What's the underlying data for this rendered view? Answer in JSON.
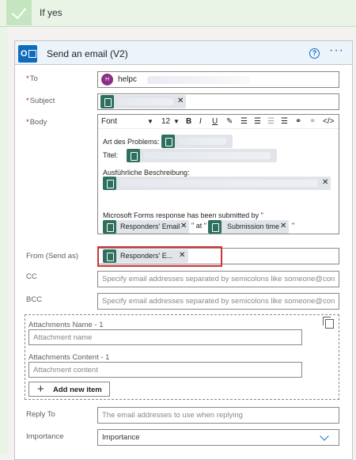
{
  "condition": {
    "label": "If yes"
  },
  "action": {
    "title": "Send an email (V2)",
    "help": "?",
    "more": "···"
  },
  "to": {
    "label": "To",
    "avatar": "H",
    "value": "helpc"
  },
  "subject": {
    "label": "Subject"
  },
  "body": {
    "label": "Body",
    "toolbar": {
      "font": "Font",
      "size": "12",
      "bold": "B",
      "italic": "I",
      "underline": "U"
    },
    "line1": "Art des Problems:",
    "line2": "Titel:",
    "line3": "Ausführliche Beschreibung:",
    "line4": "Microsoft Forms response has been submitted by \"",
    "token_email": "Responders' Email",
    "at_text": "\" at \"",
    "token_time": "Submission time",
    "end_quote": "\""
  },
  "from": {
    "label": "From (Send as)",
    "token": "Responders' E..."
  },
  "cc": {
    "label": "CC",
    "placeholder": "Specify email addresses separated by semicolons like someone@con"
  },
  "bcc": {
    "label": "BCC",
    "placeholder": "Specify email addresses separated by semicolons like someone@con"
  },
  "attachments": {
    "name_label": "Attachments Name - 1",
    "name_placeholder": "Attachment name",
    "content_label": "Attachments Content - 1",
    "content_placeholder": "Attachment content",
    "add_button": "Add new item"
  },
  "reply_to": {
    "label": "Reply To",
    "placeholder": "The email addresses to use when replying"
  },
  "importance": {
    "label": "Importance",
    "value": "Importance"
  },
  "icons": [
    "check-icon",
    "outlook-icon",
    "help-icon",
    "more-icon",
    "forms-token-icon",
    "remove-icon",
    "duplicate-icon",
    "chevron-down-icon"
  ],
  "colors": {
    "accent": "#0f6cbd",
    "highlight": "#d13438",
    "condition_bg": "#e9f3e6",
    "token_icon": "#2e6f5e"
  }
}
